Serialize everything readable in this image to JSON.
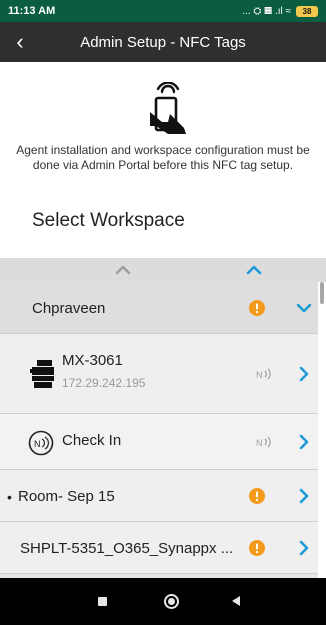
{
  "status_bar": {
    "time": "11:13 AM",
    "indicators": "... ⛭ ▦ .ıl ≈",
    "battery": "38"
  },
  "app_bar": {
    "title": "Admin Setup - NFC Tags",
    "back_icon": "back-arrow-icon"
  },
  "instruction": "Agent installation and workspace configuration must be done via Admin Portal before this NFC tag setup.",
  "section_heading": "Select Workspace",
  "list": {
    "group": {
      "label": "Chpraveen",
      "expanded": true
    },
    "device": {
      "name": "MX-3061",
      "ip": "172.29.242.195"
    },
    "checkin": {
      "label": "Check In"
    },
    "room": {
      "bullet": "•",
      "label": "Room- Sep 15"
    },
    "shplt": {
      "label": "SHPLT-5351_O365_Synappx ..."
    }
  },
  "colors": {
    "status_bar": "#0b5d3f",
    "app_bar": "#2f2f2f",
    "accent": "#1e9ad6",
    "alert": "#f39a1c",
    "inactive": "#9e9e9e"
  }
}
